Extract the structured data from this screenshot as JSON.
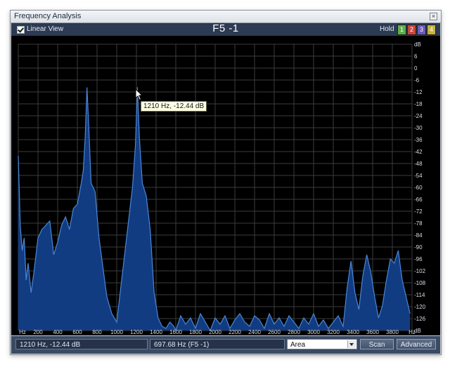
{
  "window": {
    "title": "Frequency Analysis",
    "close_glyph": "×"
  },
  "toolbar": {
    "linear_view_label": "Linear View",
    "linear_view_checked": true,
    "note_title": "F5 -1",
    "hold_label": "Hold",
    "hold_buttons": [
      {
        "label": "1",
        "color": "#5fae4a"
      },
      {
        "label": "2",
        "color": "#c9473e"
      },
      {
        "label": "3",
        "color": "#6b5bb8"
      },
      {
        "label": "4",
        "color": "#c8b23c"
      }
    ]
  },
  "tooltip": {
    "text": "1210 Hz, -12.44 dB"
  },
  "status": {
    "cursor_readout": "1210 Hz, -12.44 dB",
    "peak_readout": "697.68 Hz (F5 -1)",
    "mode_value": "Area",
    "scan_label": "Scan",
    "advanced_label": "Advanced"
  },
  "colors": {
    "accent": "#4a86d6",
    "fill": "#123c82",
    "grid": "#3c3c3c",
    "background": "#000000"
  },
  "chart_data": {
    "type": "area",
    "xlabel": "Hz",
    "ylabel": "dB",
    "x_ticks": [
      "Hz",
      "200",
      "400",
      "600",
      "800",
      "1000",
      "1200",
      "1400",
      "1600",
      "1800",
      "2000",
      "2200",
      "2400",
      "2600",
      "2800",
      "3000",
      "3200",
      "3400",
      "3600",
      "3800",
      "Hz"
    ],
    "y_ticks": [
      "dB",
      "6",
      "0",
      "-6",
      "-12",
      "-18",
      "-24",
      "-30",
      "-36",
      "-42",
      "-48",
      "-54",
      "-60",
      "-66",
      "-72",
      "-78",
      "-84",
      "-90",
      "-96",
      "-102",
      "-108",
      "-114",
      "-120",
      "-126",
      "dB"
    ],
    "xlim": [
      0,
      4000
    ],
    "ylim": [
      -128,
      8
    ],
    "grid": true,
    "x": [
      0,
      20,
      40,
      60,
      80,
      100,
      130,
      160,
      200,
      240,
      280,
      320,
      360,
      400,
      440,
      480,
      520,
      560,
      600,
      640,
      660,
      680,
      697.68,
      715,
      740,
      780,
      820,
      860,
      900,
      950,
      1000,
      1040,
      1080,
      1120,
      1160,
      1190,
      1210,
      1230,
      1260,
      1300,
      1340,
      1380,
      1420,
      1460,
      1500,
      1540,
      1580,
      1600,
      1650,
      1700,
      1750,
      1800,
      1850,
      1900,
      1950,
      2000,
      2050,
      2100,
      2150,
      2200,
      2250,
      2300,
      2350,
      2400,
      2450,
      2500,
      2550,
      2600,
      2650,
      2700,
      2750,
      2800,
      2850,
      2900,
      2950,
      3000,
      3050,
      3100,
      3150,
      3200,
      3250,
      3300,
      3340,
      3380,
      3420,
      3460,
      3500,
      3540,
      3580,
      3620,
      3660,
      3700,
      3740,
      3780,
      3820,
      3860,
      3900,
      3940,
      3980
    ],
    "y": [
      -45,
      -78,
      -90,
      -84,
      -104,
      -96,
      -110,
      -100,
      -84,
      -80,
      -78,
      -76,
      -92,
      -86,
      -78,
      -74,
      -80,
      -70,
      -68,
      -58,
      -52,
      -36,
      -12.5,
      -30,
      -58,
      -62,
      -84,
      -98,
      -112,
      -120,
      -124,
      -108,
      -92,
      -76,
      -60,
      -40,
      -12.44,
      -36,
      -58,
      -64,
      -80,
      -110,
      -122,
      -126,
      -127,
      -124,
      -126,
      -128,
      -121,
      -125,
      -122,
      -127,
      -120,
      -124,
      -128,
      -122,
      -125,
      -121,
      -127,
      -123,
      -120,
      -124,
      -126,
      -121,
      -123,
      -127,
      -120,
      -125,
      -122,
      -126,
      -121,
      -124,
      -127,
      -122,
      -125,
      -120,
      -126,
      -123,
      -127,
      -124,
      -121,
      -126,
      -108,
      -95,
      -110,
      -118,
      -102,
      -92,
      -100,
      -112,
      -122,
      -116,
      -104,
      -94,
      -96,
      -90,
      -104,
      -112,
      -120
    ]
  }
}
